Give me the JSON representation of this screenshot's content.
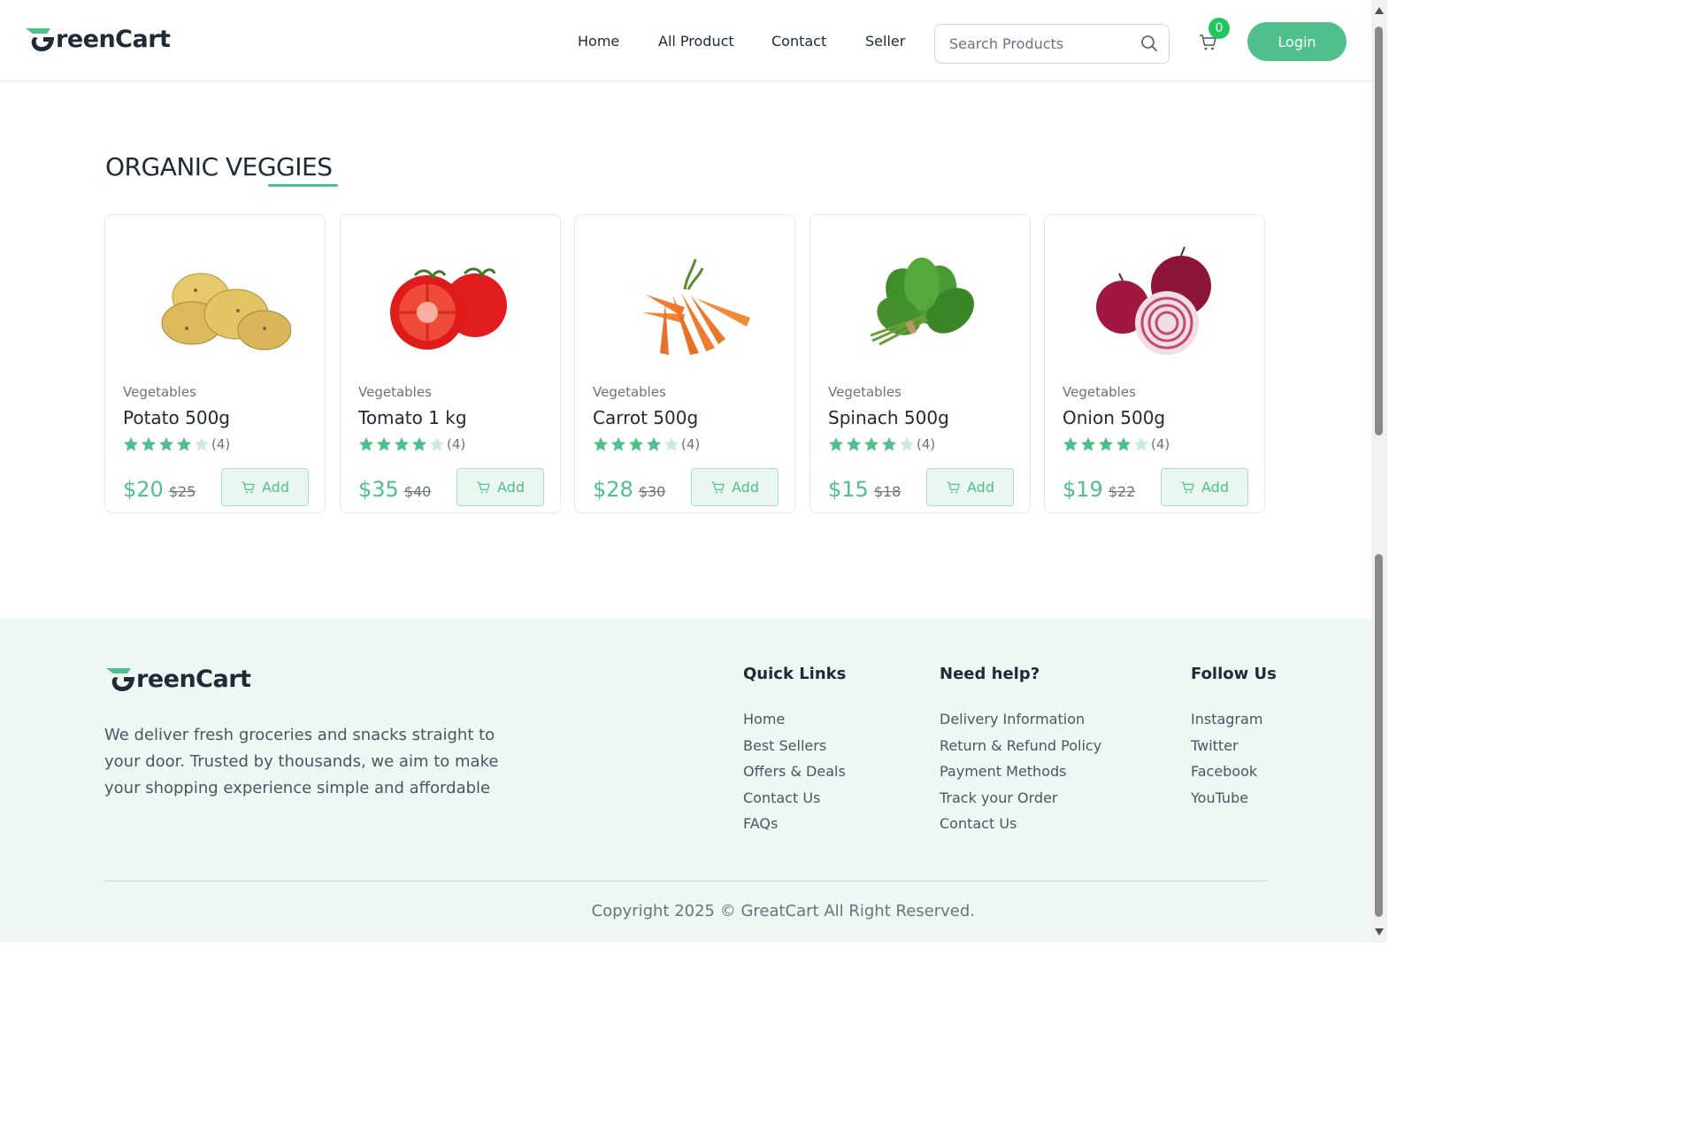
{
  "brand": {
    "name": "reenCart",
    "accent": "#4fbf8b"
  },
  "nav": {
    "items": [
      "Home",
      "All Product",
      "Contact",
      "Seller"
    ]
  },
  "search": {
    "placeholder": "Search Products"
  },
  "cart": {
    "count": "0"
  },
  "login": {
    "label": "Login"
  },
  "section": {
    "title": "ORGANIC VEGGIES"
  },
  "products": [
    {
      "category": "Vegetables",
      "name": "Potato 500g",
      "rating": 4,
      "reviews": "(4)",
      "price": "$20",
      "old_price": "$25",
      "add_label": "Add",
      "image": "potato"
    },
    {
      "category": "Vegetables",
      "name": "Tomato 1 kg",
      "rating": 4,
      "reviews": "(4)",
      "price": "$35",
      "old_price": "$40",
      "add_label": "Add",
      "image": "tomato"
    },
    {
      "category": "Vegetables",
      "name": "Carrot 500g",
      "rating": 4,
      "reviews": "(4)",
      "price": "$28",
      "old_price": "$30",
      "add_label": "Add",
      "image": "carrot"
    },
    {
      "category": "Vegetables",
      "name": "Spinach 500g",
      "rating": 4,
      "reviews": "(4)",
      "price": "$15",
      "old_price": "$18",
      "add_label": "Add",
      "image": "spinach"
    },
    {
      "category": "Vegetables",
      "name": "Onion 500g",
      "rating": 4,
      "reviews": "(4)",
      "price": "$19",
      "old_price": "$22",
      "add_label": "Add",
      "image": "onion"
    }
  ],
  "footer": {
    "description": "We deliver fresh groceries and snacks straight to your door. Trusted by thousands, we aim to make your shopping experience simple and affordable",
    "quick_links": {
      "title": "Quick Links",
      "items": [
        "Home",
        "Best Sellers",
        "Offers & Deals",
        "Contact Us",
        "FAQs"
      ]
    },
    "need_help": {
      "title": "Need help?",
      "items": [
        "Delivery Information",
        "Return & Refund Policy",
        "Payment Methods",
        "Track your Order",
        "Contact Us"
      ]
    },
    "follow_us": {
      "title": "Follow Us",
      "items": [
        "Instagram",
        "Twitter",
        "Facebook",
        "YouTube"
      ]
    },
    "copyright": "Copyright 2025 © GreatCart All Right Reserved."
  }
}
